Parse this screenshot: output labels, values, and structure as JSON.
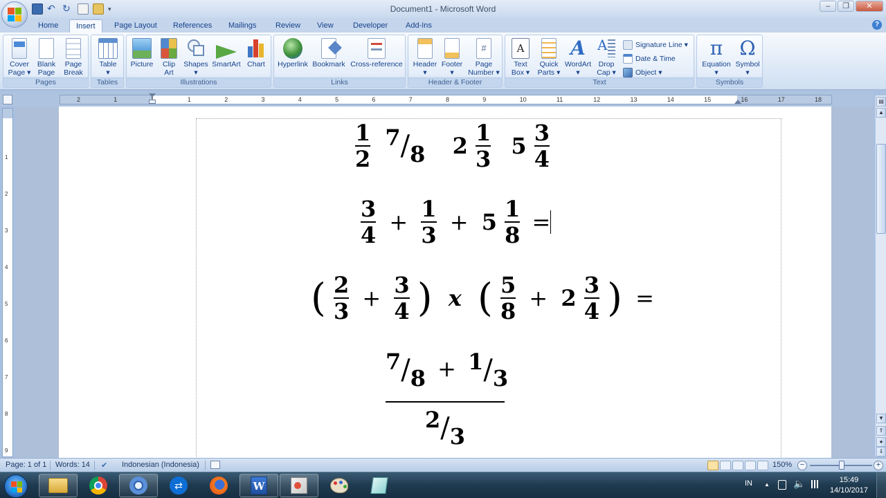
{
  "window": {
    "title": "Document1 - Microsoft Word",
    "controls": [
      "–",
      "❐",
      "✕"
    ]
  },
  "tabs": [
    "Home",
    "Insert",
    "Page Layout",
    "References",
    "Mailings",
    "Review",
    "View",
    "Developer",
    "Add-Ins"
  ],
  "active_tab": "Insert",
  "ribbon": {
    "groups": {
      "pages": "Pages",
      "tables": "Tables",
      "illustrations": "Illustrations",
      "links": "Links",
      "header_footer": "Header & Footer",
      "text": "Text",
      "symbols": "Symbols"
    },
    "buttons": {
      "cover_page": [
        "Cover",
        "Page ▾"
      ],
      "blank_page": [
        "Blank",
        "Page"
      ],
      "page_break": [
        "Page",
        "Break"
      ],
      "table": [
        "Table",
        "▾"
      ],
      "picture": [
        "Picture",
        ""
      ],
      "clip_art": [
        "Clip",
        "Art"
      ],
      "shapes": [
        "Shapes",
        "▾"
      ],
      "smartart": [
        "SmartArt",
        ""
      ],
      "chart": [
        "Chart",
        ""
      ],
      "hyperlink": [
        "Hyperlink",
        ""
      ],
      "bookmark": [
        "Bookmark",
        ""
      ],
      "cross_reference": [
        "Cross-reference",
        ""
      ],
      "header": [
        "Header",
        "▾"
      ],
      "footer": [
        "Footer",
        "▾"
      ],
      "page_number": [
        "Page",
        "Number ▾"
      ],
      "text_box": [
        "Text",
        "Box ▾"
      ],
      "quick_parts": [
        "Quick",
        "Parts ▾"
      ],
      "wordart": [
        "WordArt",
        "▾"
      ],
      "drop_cap": [
        "Drop",
        "Cap ▾"
      ],
      "equation": [
        "Equation",
        "▾"
      ],
      "symbol": [
        "Symbol",
        "▾"
      ]
    },
    "small_buttons": {
      "signature_line": "Signature Line ▾",
      "date_time": "Date & Time",
      "object": "Object ▾"
    }
  },
  "ruler": {
    "h_labels": [
      "2",
      "1",
      "1",
      "1",
      "2",
      "3",
      "4",
      "5",
      "6",
      "7",
      "8",
      "9",
      "10",
      "11",
      "12",
      "13",
      "14",
      "15",
      "16",
      "17",
      "18"
    ],
    "v_labels": [
      "1",
      "2",
      "3",
      "4",
      "5",
      "6",
      "7",
      "8",
      "9"
    ]
  },
  "document": {
    "eq1": {
      "f1_num": "1",
      "f1_den": "2",
      "l1_num": "7",
      "l1_den": "8",
      "m1_whole": "2",
      "m1_num": "1",
      "m1_den": "3",
      "m2_whole": "5",
      "m2_num": "3",
      "m2_den": "4"
    },
    "eq2": {
      "f1_num": "3",
      "f1_den": "4",
      "op1": "+",
      "f2_num": "1",
      "f2_den": "3",
      "op2": "+",
      "m_whole": "5",
      "m_num": "1",
      "m_den": "8",
      "eq": "="
    },
    "eq3": {
      "lp1": "(",
      "f1_num": "2",
      "f1_den": "3",
      "op1": "+",
      "f2_num": "3",
      "f2_den": "4",
      "rp1": ")",
      "times": "x",
      "lp2": "(",
      "f3_num": "5",
      "f3_den": "8",
      "op2": "+",
      "m_whole": "2",
      "m_num": "3",
      "m_den": "4",
      "rp2": ")",
      "eq": "="
    },
    "eq4": {
      "t1_num": "7",
      "t1_den": "8",
      "op": "+",
      "t2_num": "1",
      "t2_den": "3",
      "b_num": "2",
      "b_den": "3"
    }
  },
  "status": {
    "page": "Page: 1 of 1",
    "words": "Words: 14",
    "language": "Indonesian (Indonesia)",
    "zoom": "150%",
    "zoom_minus": "−",
    "zoom_plus": "+"
  },
  "taskbar": {
    "lang": "IN",
    "time": "15:49",
    "date": "14/10/2017",
    "tray_up": "▲"
  },
  "colors": {
    "ribbon_text": "#15428b",
    "window_chrome": "#c4d5ec",
    "taskbar": "#1f3a4f"
  }
}
